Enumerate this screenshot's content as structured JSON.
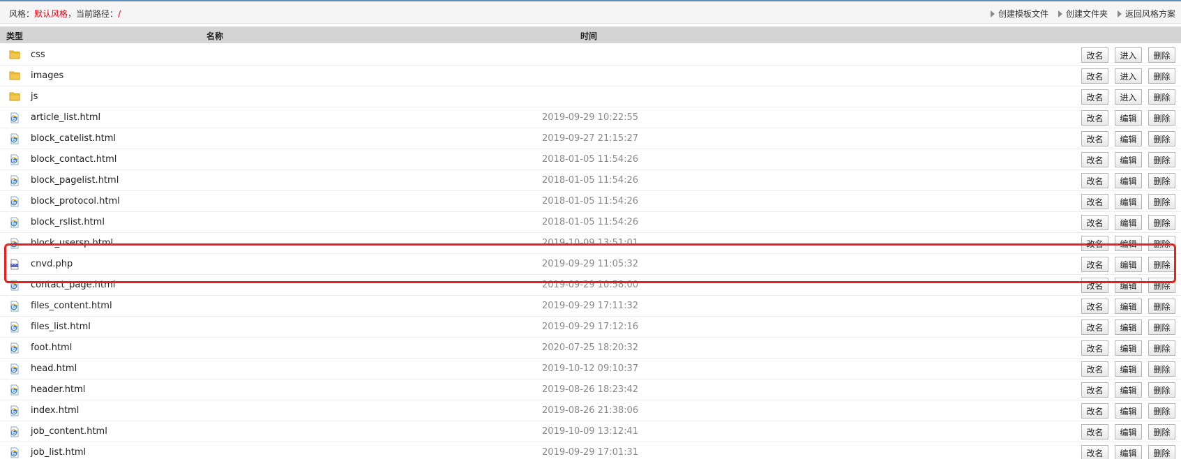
{
  "topbar": {
    "style_label": "风格：",
    "style_value": "默认风格",
    "sep": "，",
    "path_label": "当前路径：",
    "path_value": "/",
    "actions": [
      {
        "label": "创建模板文件"
      },
      {
        "label": "创建文件夹"
      },
      {
        "label": "返回风格方案"
      }
    ]
  },
  "table": {
    "headers": {
      "type": "类型",
      "name": "名称",
      "time": "时间"
    },
    "rows": [
      {
        "kind": "folder",
        "name": "css",
        "time": "",
        "buttons": [
          "改名",
          "进入",
          "删除"
        ]
      },
      {
        "kind": "folder",
        "name": "images",
        "time": "",
        "buttons": [
          "改名",
          "进入",
          "删除"
        ]
      },
      {
        "kind": "folder",
        "name": "js",
        "time": "",
        "buttons": [
          "改名",
          "进入",
          "删除"
        ]
      },
      {
        "kind": "html",
        "name": "article_list.html",
        "time": "2019-09-29 10:22:55",
        "buttons": [
          "改名",
          "编辑",
          "删除"
        ]
      },
      {
        "kind": "html",
        "name": "block_catelist.html",
        "time": "2019-09-27 21:15:27",
        "buttons": [
          "改名",
          "编辑",
          "删除"
        ]
      },
      {
        "kind": "html",
        "name": "block_contact.html",
        "time": "2018-01-05 11:54:26",
        "buttons": [
          "改名",
          "编辑",
          "删除"
        ]
      },
      {
        "kind": "html",
        "name": "block_pagelist.html",
        "time": "2018-01-05 11:54:26",
        "buttons": [
          "改名",
          "编辑",
          "删除"
        ]
      },
      {
        "kind": "html",
        "name": "block_protocol.html",
        "time": "2018-01-05 11:54:26",
        "buttons": [
          "改名",
          "编辑",
          "删除"
        ]
      },
      {
        "kind": "html",
        "name": "block_rslist.html",
        "time": "2018-01-05 11:54:26",
        "buttons": [
          "改名",
          "编辑",
          "删除"
        ]
      },
      {
        "kind": "html",
        "name": "block_usersp.html",
        "time": "2019-10-09 13:51:01",
        "buttons": [
          "改名",
          "编辑",
          "删除"
        ]
      },
      {
        "kind": "php",
        "name": "cnvd.php",
        "time": "2019-09-29 11:05:32",
        "buttons": [
          "改名",
          "编辑",
          "删除"
        ]
      },
      {
        "kind": "html",
        "name": "contact_page.html",
        "time": "2019-09-29 10:58:00",
        "buttons": [
          "改名",
          "编辑",
          "删除"
        ]
      },
      {
        "kind": "html",
        "name": "files_content.html",
        "time": "2019-09-29 17:11:32",
        "buttons": [
          "改名",
          "编辑",
          "删除"
        ]
      },
      {
        "kind": "html",
        "name": "files_list.html",
        "time": "2019-09-29 17:12:16",
        "buttons": [
          "改名",
          "编辑",
          "删除"
        ]
      },
      {
        "kind": "html",
        "name": "foot.html",
        "time": "2020-07-25 18:20:32",
        "buttons": [
          "改名",
          "编辑",
          "删除"
        ]
      },
      {
        "kind": "html",
        "name": "head.html",
        "time": "2019-10-12 09:10:37",
        "buttons": [
          "改名",
          "编辑",
          "删除"
        ]
      },
      {
        "kind": "html",
        "name": "header.html",
        "time": "2019-08-26 18:23:42",
        "buttons": [
          "改名",
          "编辑",
          "删除"
        ]
      },
      {
        "kind": "html",
        "name": "index.html",
        "time": "2019-08-26 21:38:06",
        "buttons": [
          "改名",
          "编辑",
          "删除"
        ]
      },
      {
        "kind": "html",
        "name": "job_content.html",
        "time": "2019-10-09 13:12:41",
        "buttons": [
          "改名",
          "编辑",
          "删除"
        ]
      },
      {
        "kind": "html",
        "name": "job_list.html",
        "time": "2019-09-29 17:01:31",
        "buttons": [
          "改名",
          "编辑",
          "删除"
        ]
      }
    ]
  },
  "colors": {
    "accent_red": "#e60012",
    "highlight": "#e8201c",
    "header_bg": "#d4d4d4",
    "time_text": "#888888"
  }
}
